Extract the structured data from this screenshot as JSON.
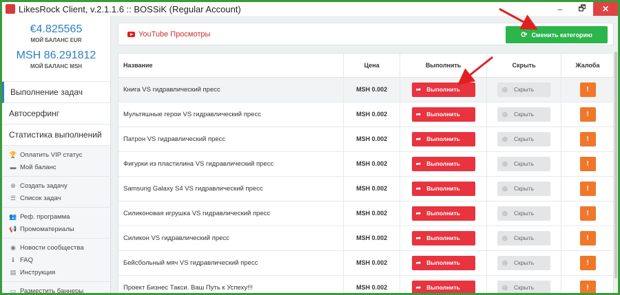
{
  "window": {
    "title": "LikesRock Client, v.2.1.1.6 :: BOSSiK (Regular Account)",
    "minimize": "‒",
    "restore": "🗗",
    "close": "✕"
  },
  "balance": {
    "eur_amount": "€4.825565",
    "eur_label": "МОЙ БАЛАНС EUR",
    "msh_amount": "MSH 86.291812",
    "msh_label": "МОЙ БАЛАНС MSH"
  },
  "sidebar": {
    "main_items": [
      "Выполнение задач",
      "Автосерфинг",
      "Статистика выполнений"
    ],
    "groups": [
      [
        {
          "icon": "trophy-icon",
          "glyph": "🏆",
          "label": "Оплатить VIP статус"
        },
        {
          "icon": "wallet-icon",
          "glyph": "▬",
          "label": "Мой баланс"
        }
      ],
      [
        {
          "icon": "plus-circle-icon",
          "glyph": "⊕",
          "label": "Создать задачу"
        },
        {
          "icon": "list-icon",
          "glyph": "☰",
          "label": "Список задач"
        }
      ],
      [
        {
          "icon": "users-icon",
          "glyph": "👥",
          "label": "Реф. программа"
        },
        {
          "icon": "megaphone-icon",
          "glyph": "📢",
          "label": "Промоматериалы"
        }
      ],
      [
        {
          "icon": "globe-icon",
          "glyph": "◉",
          "label": "Новости сообщества"
        },
        {
          "icon": "info-icon",
          "glyph": "ℹ",
          "label": "FAQ"
        },
        {
          "icon": "book-icon",
          "glyph": "▤",
          "label": "Инструкция"
        }
      ],
      [
        {
          "icon": "monitor-icon",
          "glyph": "▭",
          "label": "Разместить баннеры"
        }
      ]
    ]
  },
  "category": {
    "title": "YouTube Просмотры",
    "change_button": "Сменить категорию"
  },
  "table": {
    "headers": {
      "name": "Название",
      "price": "Цена",
      "execute": "Выполнить",
      "hide": "Скрыть",
      "complaint": "Жалоба"
    },
    "execute_label": "Выполнить",
    "hide_label": "Скрыть",
    "complaint_glyph": "!",
    "rows": [
      {
        "name": "Книга VS гидравлический пресс",
        "price": "MSH 0.002"
      },
      {
        "name": "Мультяшные герои VS гидравлический пресс",
        "price": "MSH 0.002"
      },
      {
        "name": "Патрон VS гидравлический пресс",
        "price": "MSH 0.002"
      },
      {
        "name": "Фигурки из пластилина VS гидравлический пресс",
        "price": "MSH 0.002"
      },
      {
        "name": "Samsung Galaxy S4 VS гидравлический пресс",
        "price": "MSH 0.002"
      },
      {
        "name": "Силиконовая игрушка VS гидравлический пресс",
        "price": "MSH 0.002"
      },
      {
        "name": "Силикон VS гидравлический пресс",
        "price": "MSH 0.002"
      },
      {
        "name": "Бейсбольный мяч VS гидравлический пресс",
        "price": "MSH 0.002"
      },
      {
        "name": "Проект Бизнес Такси. Ваш Путь к Успеху!!!",
        "price": "MSH 0.002"
      }
    ]
  },
  "colors": {
    "accent_blue": "#2a7fc4",
    "execute_red": "#e8343f",
    "change_green": "#2cb54a",
    "warn_orange": "#f0772a",
    "frame_green": "#3b9a3b",
    "annotation_arrow": "#e02020"
  }
}
